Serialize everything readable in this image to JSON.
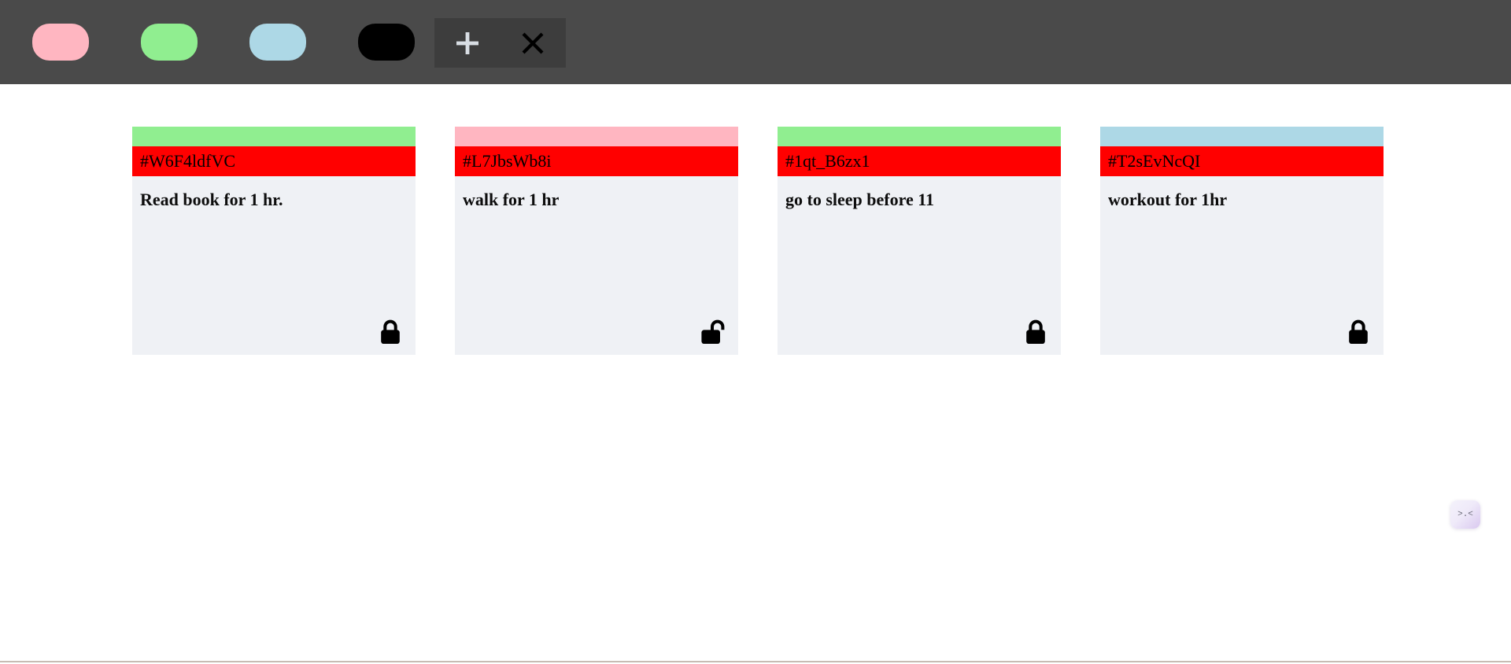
{
  "toolbar": {
    "background_color": "#4a4a4a",
    "swatches": [
      {
        "name": "swatch-pink",
        "label": "Pink",
        "color": "#ffb6c1"
      },
      {
        "name": "swatch-green",
        "label": "Green",
        "color": "#90ee90"
      },
      {
        "name": "swatch-blue",
        "label": "Light Blue",
        "color": "#add8e6"
      },
      {
        "name": "swatch-black",
        "label": "Black",
        "color": "#000000"
      }
    ],
    "actions": [
      {
        "name": "add-note-button",
        "icon": "plus-icon",
        "label": "+",
        "color": "#d8dde3"
      },
      {
        "name": "close-note-button",
        "icon": "close-icon",
        "label": "X",
        "color": "#000000"
      }
    ]
  },
  "board": {
    "id_bar_color": "#ff0000",
    "card_body_color": "#eff1f5",
    "cards": [
      {
        "id": "#W6F4ldfVC",
        "text": "Read book for 1 hr.",
        "color": "#90ee90",
        "color_name": "green",
        "locked": true,
        "lock_icon": "lock-closed-icon"
      },
      {
        "id": "#L7JbsWb8i",
        "text": "walk for 1 hr",
        "color": "#ffb6c1",
        "color_name": "pink",
        "locked": false,
        "lock_icon": "lock-open-icon"
      },
      {
        "id": "#1qt_B6zx1",
        "text": "go to sleep before 11",
        "color": "#90ee90",
        "color_name": "green",
        "locked": true,
        "lock_icon": "lock-closed-icon"
      },
      {
        "id": "#T2sEvNcQI",
        "text": "workout for 1hr",
        "color": "#add8e6",
        "color_name": "light-blue",
        "locked": true,
        "lock_icon": "lock-closed-icon"
      }
    ]
  },
  "assistant": {
    "face": ">.<",
    "icon": "assistant-face-icon"
  }
}
